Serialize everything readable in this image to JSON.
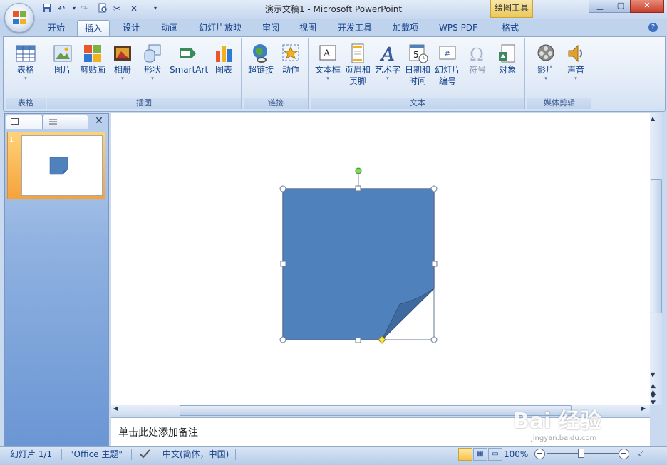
{
  "window": {
    "title": "演示文稿1 - Microsoft PowerPoint",
    "context_tab": "绘图工具"
  },
  "tabs": [
    "开始",
    "插入",
    "设计",
    "动画",
    "幻灯片放映",
    "审阅",
    "视图",
    "开发工具",
    "加载项",
    "WPS PDF",
    "格式"
  ],
  "active_tab": "插入",
  "ribbon": {
    "groups": {
      "tables": {
        "label": "表格",
        "buttons": {
          "table": "表格"
        }
      },
      "illustrations": {
        "label": "插图",
        "buttons": {
          "picture": "图片",
          "clipart": "剪贴画",
          "album": "相册",
          "shapes": "形状",
          "smartart": "SmartArt",
          "chart": "图表"
        }
      },
      "links": {
        "label": "链接",
        "buttons": {
          "hyperlink": "超链接",
          "action": "动作"
        }
      },
      "text": {
        "label": "文本",
        "buttons": {
          "textbox": "文本框",
          "header_footer_1": "页眉和",
          "header_footer_2": "页脚",
          "wordart": "艺术字",
          "datetime_1": "日期和",
          "datetime_2": "时间",
          "slide_number_1": "幻灯片",
          "slide_number_2": "编号",
          "symbol": "符号",
          "object": "对象"
        }
      },
      "media": {
        "label": "媒体剪辑",
        "buttons": {
          "movie": "影片",
          "sound": "声音"
        }
      }
    }
  },
  "slides_pane": {
    "thumbnail_number": "1"
  },
  "notes": {
    "placeholder": "单击此处添加备注"
  },
  "status": {
    "slide": "幻灯片 1/1",
    "theme": "\"Office 主题\"",
    "language": "中文(简体，中国)",
    "zoom": "100%"
  },
  "watermark": {
    "main": "Bai 经验",
    "sub": "jingyan.baidu.com"
  },
  "colors": {
    "shape_fill": "#4f81bd",
    "shape_fold": "#3f6aa0",
    "accent_orange": "#f6a23a"
  }
}
